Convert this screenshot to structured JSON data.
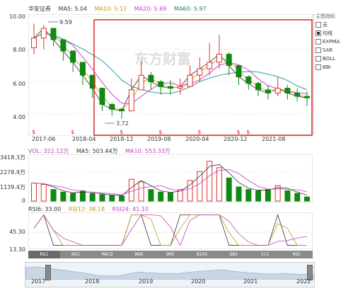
{
  "header": {
    "stock_name": "华安证券",
    "ma5": "MA5: 5.04",
    "ma10": "MA10: 5.12",
    "ma20": "MA20: 5.69",
    "ma60": "MA60: 5.97"
  },
  "sidebar": {
    "title": "主图指标",
    "items": [
      {
        "label": "无",
        "checked": false
      },
      {
        "label": "均线",
        "checked": true
      },
      {
        "label": "EXPMA",
        "checked": false
      },
      {
        "label": "SAR",
        "checked": false
      },
      {
        "label": "BOLL",
        "checked": false
      },
      {
        "label": "BBI",
        "checked": false
      }
    ]
  },
  "main_chart": {
    "y_ticks": [
      "10.00",
      "8.00",
      "6.00",
      "4.00"
    ],
    "x_ticks": [
      "2017-06",
      "2018-04",
      "2018-12",
      "2019-08",
      "2020-04",
      "2020-12",
      "2021-08"
    ],
    "high_annotation": "9.59",
    "low_annotation": "3.72",
    "watermark": "东方财富",
    "colors": {
      "up": "#e03030",
      "down": "#118811",
      "ma5": "#555555",
      "ma10": "#d4b23a",
      "ma20": "#cc44cc",
      "ma60": "#2a9d8f",
      "highlight": "#d62828"
    }
  },
  "volume_chart": {
    "vol": "VOL: 322.12万",
    "ma5": "MA5: 503.44万",
    "ma10": "MA10: 553.33万",
    "y_ticks": [
      "3418.3万",
      "2278.9万",
      "1139.4万",
      "0"
    ]
  },
  "rsi_chart": {
    "rsi6": "RSI6: 33.00",
    "rsi12": "RSI12: 38.18",
    "rsi24": "RSI24: 41.10",
    "y_ticks": [
      "45.30",
      "13.30"
    ]
  },
  "indicator_tabs": [
    "RSI",
    "KDJ",
    "MACD",
    "W&R",
    "DMI",
    "BIAS",
    "OBV",
    "CCI",
    "ROC"
  ],
  "navigator": {
    "years": [
      "2017",
      "2018",
      "2019",
      "2020",
      "2021",
      "2022"
    ]
  },
  "chart_data": {
    "type": "candlestick",
    "x": [
      "2017-06",
      "2017-08",
      "2017-10",
      "2017-12",
      "2018-02",
      "2018-04",
      "2018-06",
      "2018-08",
      "2018-10",
      "2018-12",
      "2019-02",
      "2019-04",
      "2019-06",
      "2019-08",
      "2019-10",
      "2019-12",
      "2020-02",
      "2020-04",
      "2020-06",
      "2020-08",
      "2020-10",
      "2020-12",
      "2021-02",
      "2021-04",
      "2021-06",
      "2021-08",
      "2021-10",
      "2021-12",
      "2022-02"
    ],
    "close": [
      8.7,
      9.3,
      8.6,
      7.9,
      7.2,
      6.4,
      5.6,
      4.6,
      4.3,
      4.2,
      5.5,
      6.4,
      6.0,
      5.7,
      5.6,
      5.7,
      6.4,
      6.8,
      7.2,
      7.7,
      7.0,
      6.3,
      5.9,
      5.5,
      5.3,
      5.6,
      5.3,
      5.1,
      5.0
    ],
    "high": [
      9.6,
      9.5,
      9.1,
      8.4,
      7.8,
      6.9,
      6.1,
      5.2,
      4.7,
      4.4,
      6.2,
      7.3,
      6.6,
      6.1,
      6.1,
      6.2,
      7.0,
      7.5,
      8.4,
      8.9,
      7.8,
      6.9,
      6.4,
      6.0,
      5.8,
      6.3,
      5.8,
      5.6,
      5.4
    ],
    "low": [
      7.7,
      8.0,
      8.2,
      7.3,
      6.6,
      5.8,
      5.0,
      4.2,
      3.9,
      3.72,
      4.3,
      5.6,
      5.5,
      5.2,
      5.2,
      5.2,
      5.7,
      6.0,
      6.4,
      6.8,
      6.4,
      5.8,
      5.5,
      5.1,
      4.9,
      5.1,
      4.9,
      4.8,
      4.5
    ],
    "volume": [
      1400,
      1300,
      900,
      700,
      600,
      800,
      600,
      500,
      450,
      400,
      1700,
      1500,
      900,
      700,
      650,
      900,
      1600,
      2300,
      3100,
      2600,
      1800,
      1100,
      900,
      800,
      900,
      1200,
      800,
      600,
      322
    ],
    "ylim": [
      3.0,
      10.0
    ]
  }
}
